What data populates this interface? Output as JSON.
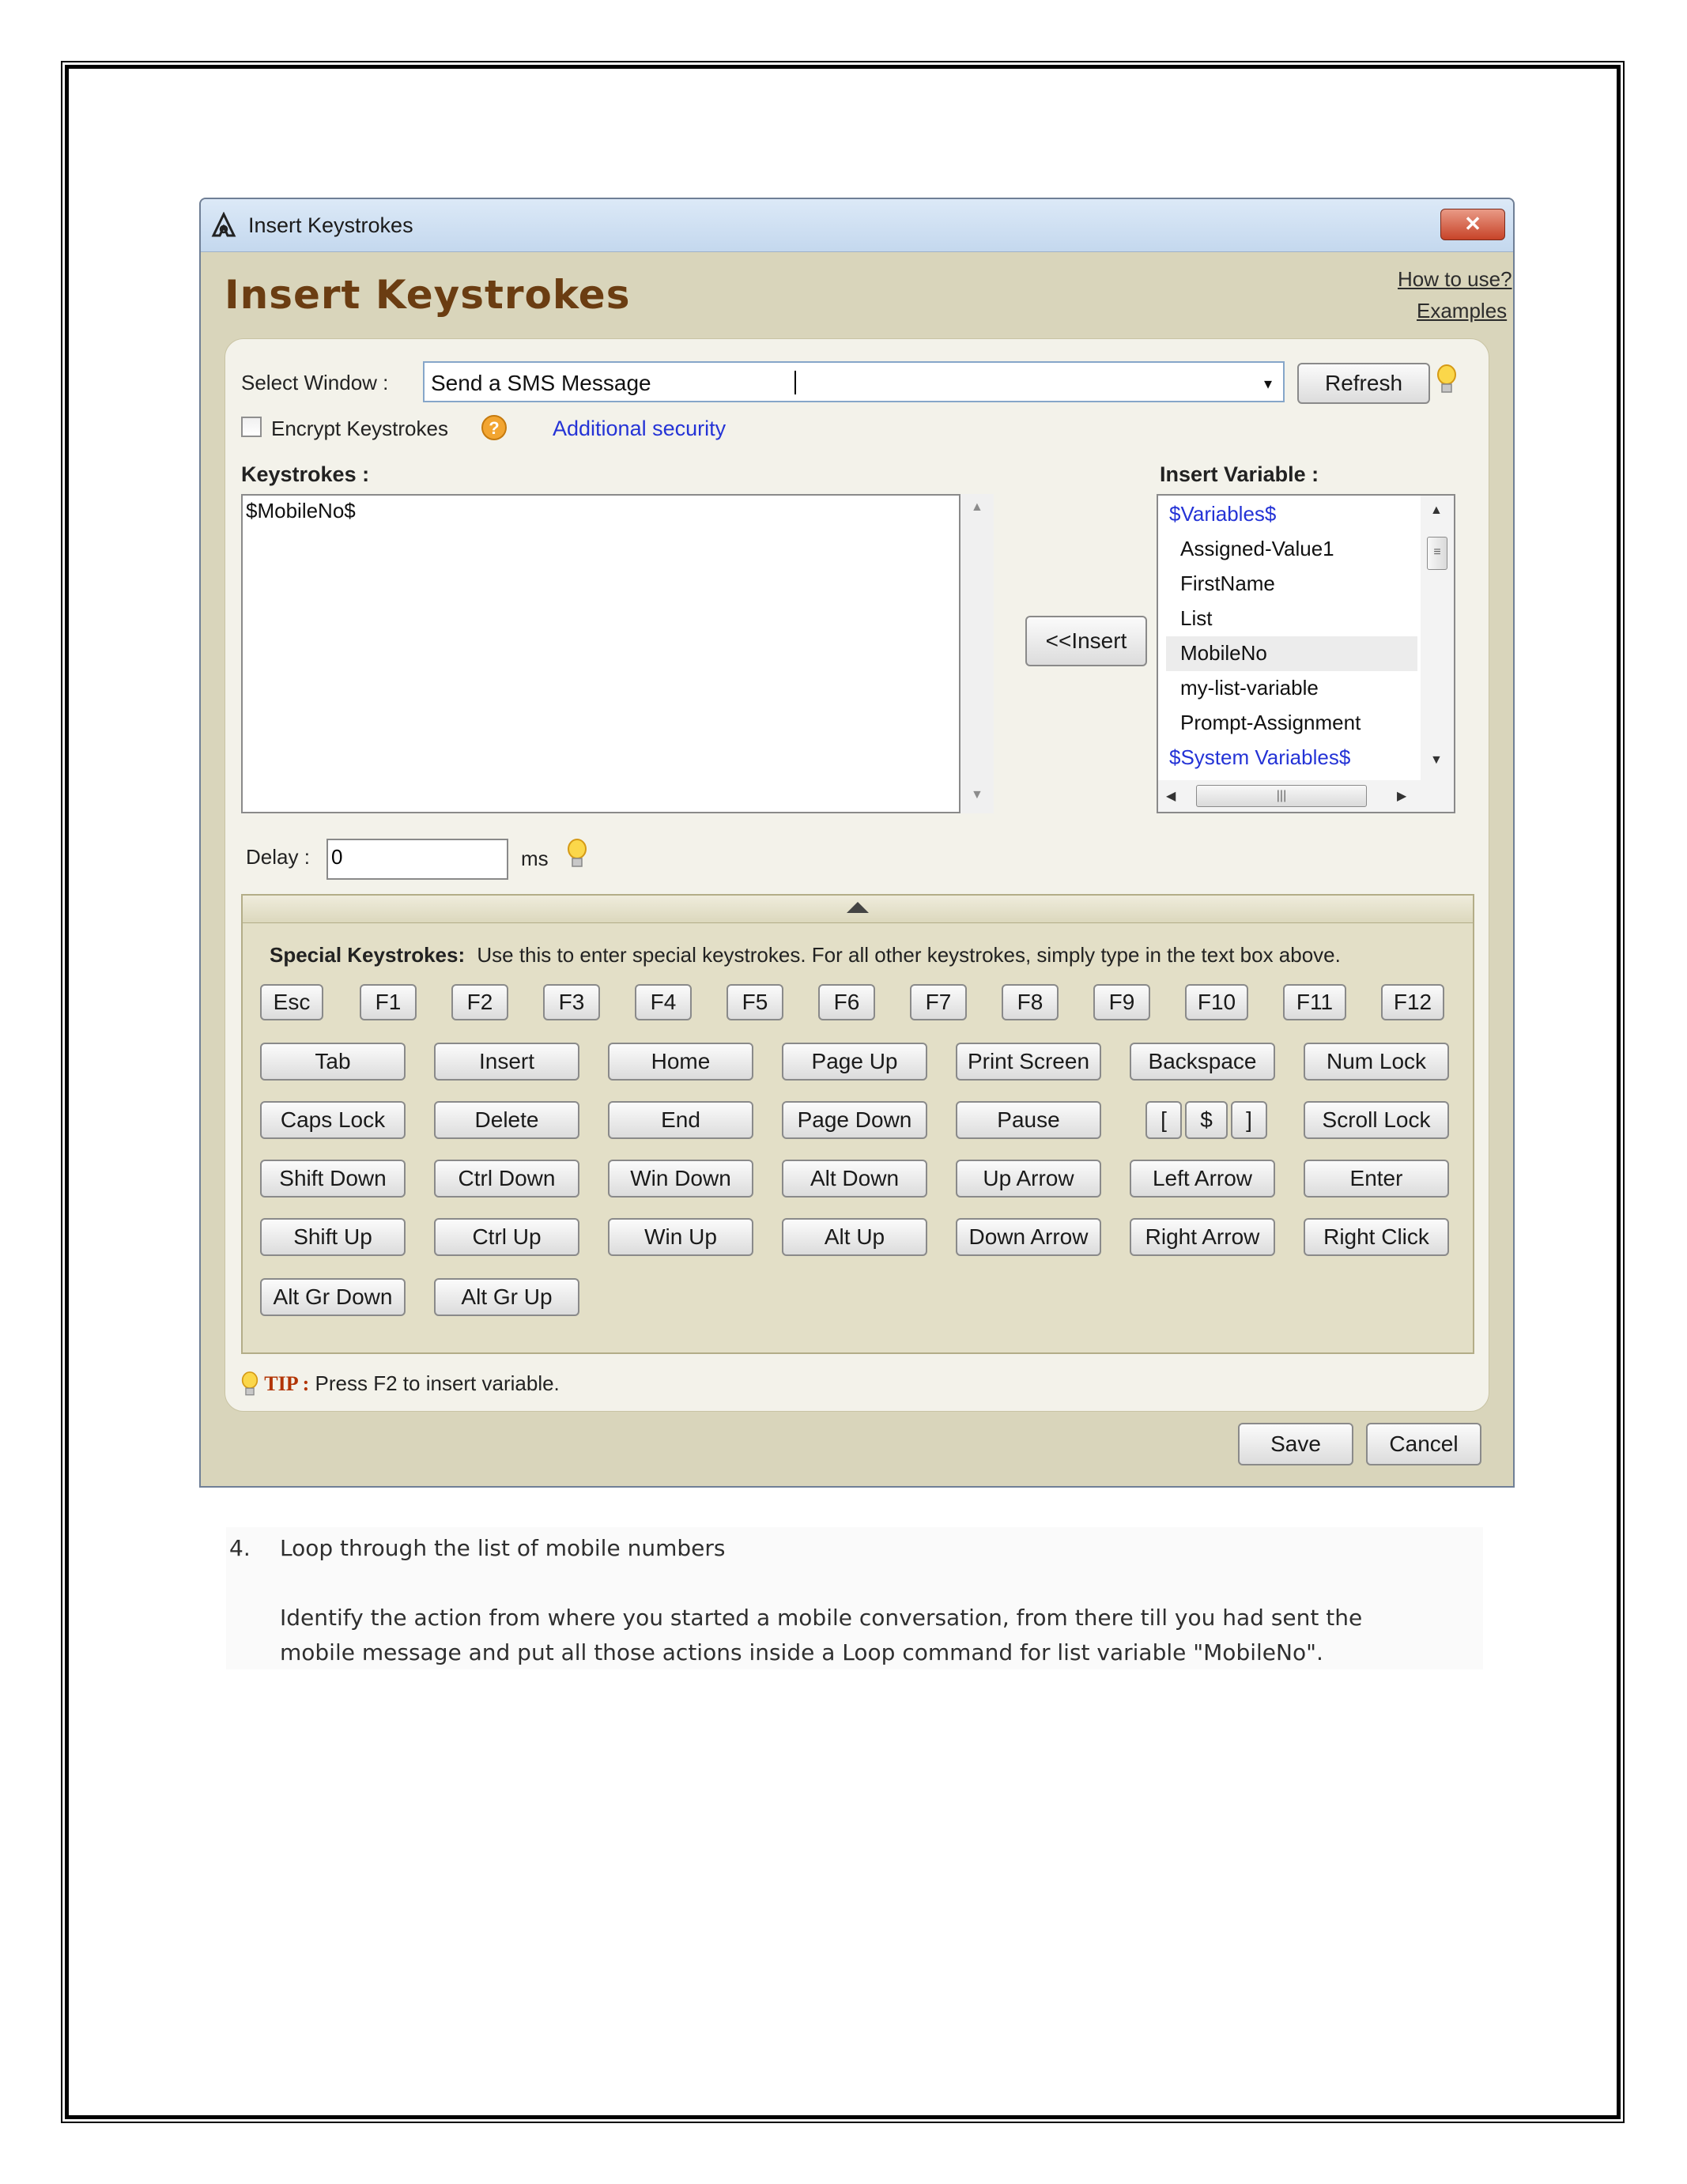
{
  "dialog": {
    "window_title": "Insert Keystrokes",
    "close_symbol": "✕",
    "heading": "Insert Keystrokes",
    "help_links": [
      "How to use?",
      "Examples"
    ],
    "select_window": {
      "label": "Select Window :",
      "value": "Send a SMS Message",
      "dropdown_icon": "▾",
      "refresh_label": "Refresh"
    },
    "encrypt": {
      "label": "Encrypt Keystrokes",
      "checked": false,
      "help_icon": "?",
      "link": "Additional security"
    },
    "keystrokes": {
      "label": "Keystrokes :",
      "value": "$MobileNo$"
    },
    "insert_button": "<<Insert",
    "insert_variable": {
      "label": "Insert Variable :",
      "groups": [
        "$Variables$",
        "$System Variables$"
      ],
      "items": [
        "Assigned-Value1",
        "FirstName",
        "List",
        "MobileNo",
        "my-list-variable",
        "Prompt-Assignment"
      ],
      "selected": "MobileNo"
    },
    "delay": {
      "label": "Delay :",
      "value": "0",
      "unit": "ms"
    },
    "special": {
      "title": "Special Keystrokes:",
      "description": "Use this to enter special keystrokes. For all other keystrokes, simply type in the text box above.",
      "function_keys": [
        "Esc",
        "F1",
        "F2",
        "F3",
        "F4",
        "F5",
        "F6",
        "F7",
        "F8",
        "F9",
        "F10",
        "F11",
        "F12"
      ],
      "rows": [
        [
          "Tab",
          "Insert",
          "Home",
          "Page Up",
          "Print Screen",
          "Backspace",
          "Num Lock"
        ],
        [
          "Caps Lock",
          "Delete",
          "End",
          "Page Down",
          "Pause",
          "$",
          "Scroll Lock"
        ],
        [
          "Shift Down",
          "Ctrl Down",
          "Win Down",
          "Alt Down",
          "Up Arrow",
          "Left Arrow",
          "Enter"
        ],
        [
          "Shift Up",
          "Ctrl Up",
          "Win Up",
          "Alt Up",
          "Down Arrow",
          "Right Arrow",
          "Right Click"
        ],
        [
          "Alt Gr Down",
          "Alt Gr Up"
        ]
      ],
      "bracket_left": "[",
      "bracket_right": "]"
    },
    "tip": {
      "label": "TIP :",
      "text": "Press F2 to insert variable."
    },
    "save_label": "Save",
    "cancel_label": "Cancel"
  },
  "document": {
    "step_number": "4.",
    "step_title": "Loop through the list of mobile numbers",
    "paragraph_line1": "Identify the action from where you started a mobile conversation, from there till you had sent the",
    "paragraph_line2": "mobile message and put all those actions inside a Loop command for list variable \"MobileNo\"."
  },
  "icons": {
    "app_icon": "app-logo-icon",
    "bulb_icon": "lightbulb-icon",
    "help_icon": "question-circle-icon"
  }
}
